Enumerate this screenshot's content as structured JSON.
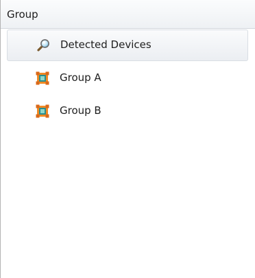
{
  "header": {
    "title": "Group"
  },
  "tree": {
    "items": [
      {
        "label": "Detected Devices",
        "icon": "search-icon",
        "selected": true
      },
      {
        "label": "Group A",
        "icon": "group-icon",
        "selected": false
      },
      {
        "label": "Group B",
        "icon": "group-icon",
        "selected": false
      }
    ]
  },
  "colors": {
    "selected_background": "#eef1f4",
    "group_icon_orange": "#f08a24",
    "group_icon_teal": "#2a8c8c"
  }
}
